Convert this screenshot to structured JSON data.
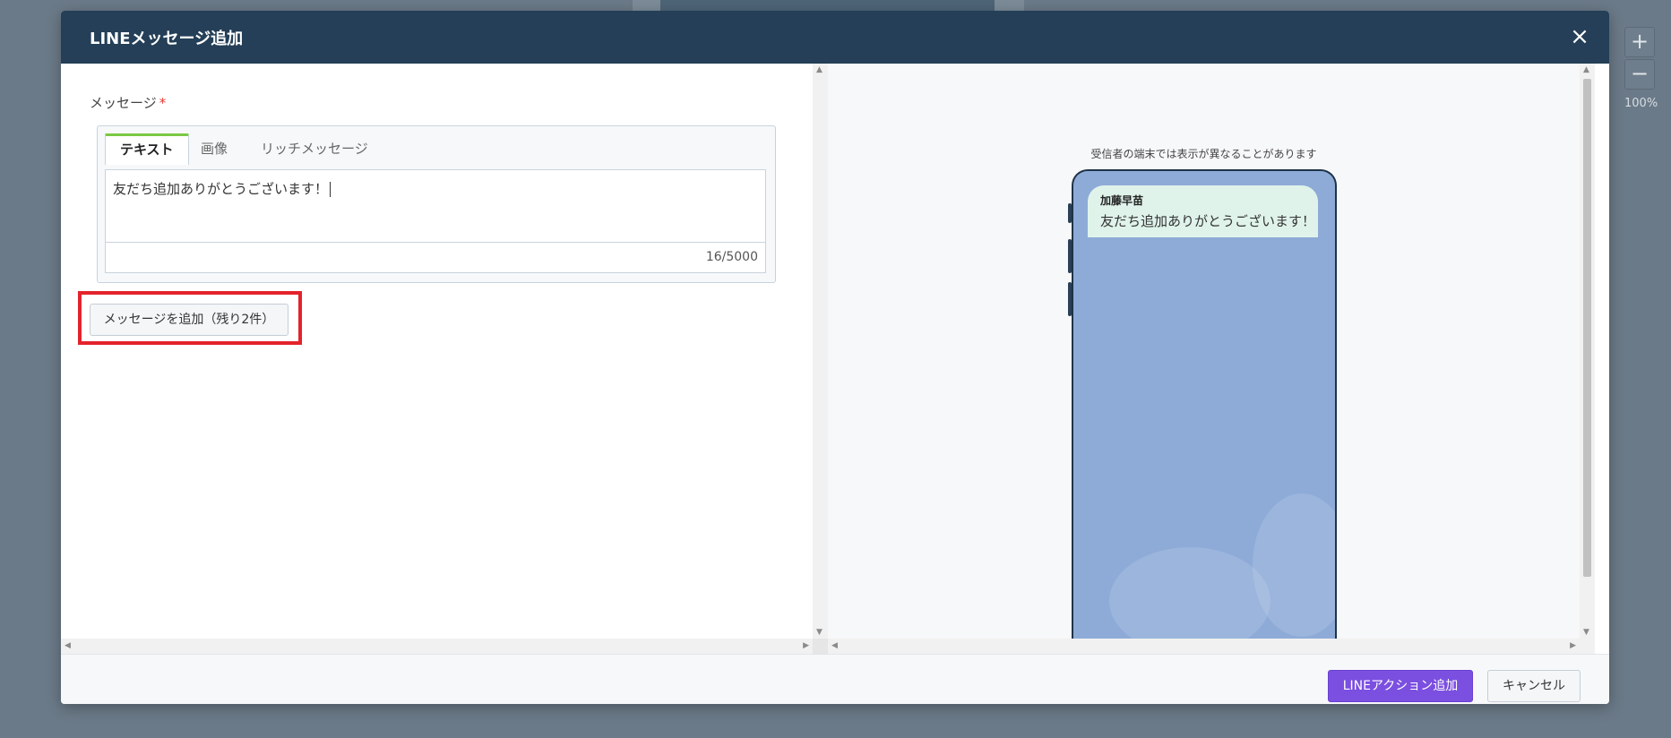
{
  "modal": {
    "title": "LINEメッセージ追加",
    "close_icon": "×"
  },
  "zoom": {
    "plus": "+",
    "minus": "−",
    "level": "100%"
  },
  "form": {
    "label": "メッセージ",
    "required_mark": "*",
    "tabs": [
      {
        "label": "テキスト",
        "active": true
      },
      {
        "label": "画像",
        "active": false
      },
      {
        "label": "リッチメッセージ",
        "active": false
      }
    ],
    "text_value": "友だち追加ありがとうございます！",
    "counter": "16/5000",
    "add_button": "メッセージを追加（残り2件）"
  },
  "preview": {
    "notice": "受信者の端末では表示が異なることがあります",
    "sender": "加藤早苗",
    "message": "友だち追加ありがとうございます！"
  },
  "footer": {
    "primary": "LINEアクション追加",
    "secondary": "キャンセル"
  },
  "colors": {
    "header": "#243f57",
    "accent_tab": "#7ac943",
    "primary_button": "#7b4fe0",
    "highlight": "#e3232c",
    "phone_screen": "#8eabd8",
    "bubble": "#dff3ea"
  }
}
